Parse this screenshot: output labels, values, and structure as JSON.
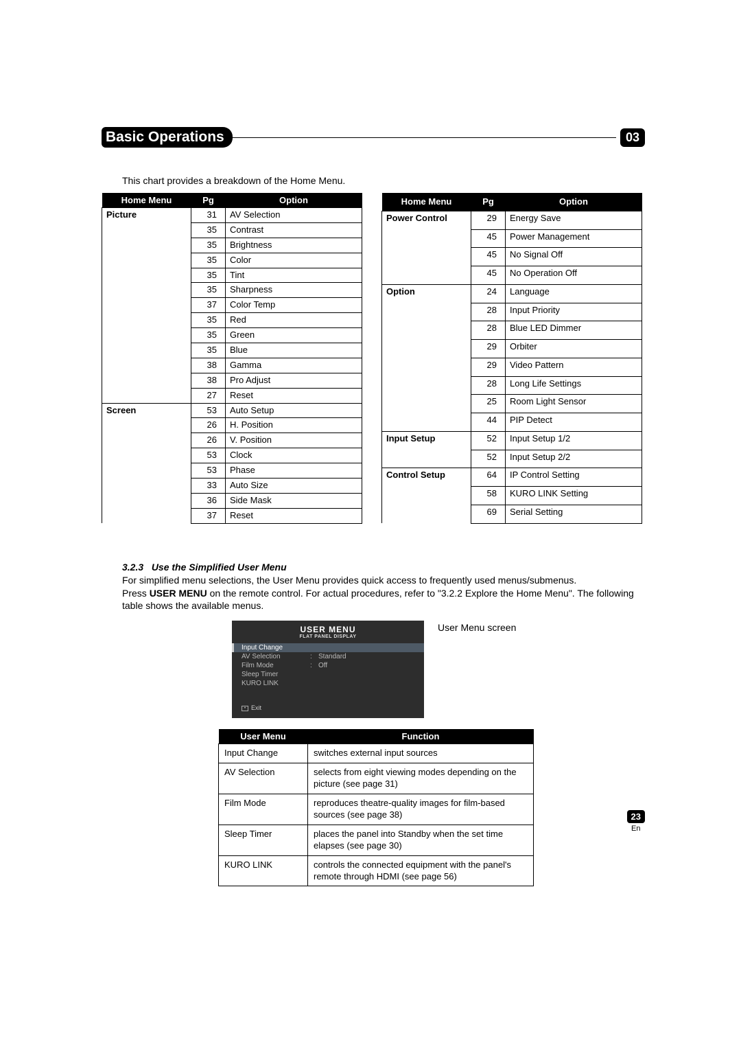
{
  "header": {
    "section_title": "Basic Operations",
    "chapter_number": "03"
  },
  "intro": "This chart provides a breakdown of the Home Menu.",
  "columns": {
    "home_menu": "Home Menu",
    "pg": "Pg",
    "option": "Option"
  },
  "left_table": [
    {
      "category": "Picture",
      "rows": [
        {
          "pg": "31",
          "option": "AV Selection"
        },
        {
          "pg": "35",
          "option": "Contrast"
        },
        {
          "pg": "35",
          "option": "Brightness"
        },
        {
          "pg": "35",
          "option": "Color"
        },
        {
          "pg": "35",
          "option": "Tint"
        },
        {
          "pg": "35",
          "option": "Sharpness"
        },
        {
          "pg": "37",
          "option": "Color Temp"
        },
        {
          "pg": "35",
          "option": "Red"
        },
        {
          "pg": "35",
          "option": "Green"
        },
        {
          "pg": "35",
          "option": "Blue"
        },
        {
          "pg": "38",
          "option": "Gamma"
        },
        {
          "pg": "38",
          "option": "Pro Adjust"
        },
        {
          "pg": "27",
          "option": "Reset"
        }
      ]
    },
    {
      "category": "Screen",
      "rows": [
        {
          "pg": "53",
          "option": "Auto Setup"
        },
        {
          "pg": "26",
          "option": "H. Position"
        },
        {
          "pg": "26",
          "option": "V. Position"
        },
        {
          "pg": "53",
          "option": "Clock"
        },
        {
          "pg": "53",
          "option": "Phase"
        },
        {
          "pg": "33",
          "option": "Auto Size"
        },
        {
          "pg": "36",
          "option": "Side Mask"
        },
        {
          "pg": "37",
          "option": "Reset"
        }
      ]
    }
  ],
  "right_table": [
    {
      "category": "Power Control",
      "rows": [
        {
          "pg": "29",
          "option": "Energy Save"
        },
        {
          "pg": "45",
          "option": "Power Management"
        },
        {
          "pg": "45",
          "option": "No Signal Off"
        },
        {
          "pg": "45",
          "option": "No Operation Off"
        }
      ]
    },
    {
      "category": "Option",
      "rows": [
        {
          "pg": "24",
          "option": "Language"
        },
        {
          "pg": "28",
          "option": "Input Priority"
        },
        {
          "pg": "28",
          "option": "Blue LED Dimmer"
        },
        {
          "pg": "29",
          "option": "Orbiter"
        },
        {
          "pg": "29",
          "option": "Video Pattern"
        },
        {
          "pg": "28",
          "option": "Long Life Settings"
        },
        {
          "pg": "25",
          "option": "Room Light Sensor"
        },
        {
          "pg": "44",
          "option": "PIP Detect"
        }
      ]
    },
    {
      "category": "Input Setup",
      "rows": [
        {
          "pg": "52",
          "option": "Input Setup 1/2"
        },
        {
          "pg": "52",
          "option": "Input Setup 2/2"
        }
      ]
    },
    {
      "category": "Control Setup",
      "rows": [
        {
          "pg": "64",
          "option": "IP Control Setting"
        },
        {
          "pg": "58",
          "option": "KURO LINK Setting"
        },
        {
          "pg": "69",
          "option": "Serial Setting"
        }
      ]
    }
  ],
  "subsection": {
    "number": "3.2.3",
    "title": "Use the Simplified User Menu",
    "para1": "For simplified menu selections, the User Menu provides quick access to frequently used menus/submenus.",
    "press_prefix": "Press ",
    "press_bold": "USER MENU",
    "press_suffix": " on the remote control. For actual procedures, refer to \"3.2.2 Explore the Home Menu\". The following table shows the available menus."
  },
  "screen": {
    "caption": "User Menu screen",
    "title": "USER MENU",
    "subtitle": "FLAT PANEL DISPLAY",
    "items": [
      {
        "label": "Input Change",
        "sep": "",
        "value": "",
        "hl": true
      },
      {
        "label": "AV Selection",
        "sep": ":",
        "value": "Standard",
        "hl": false
      },
      {
        "label": "Film Mode",
        "sep": ":",
        "value": "Off",
        "hl": false
      },
      {
        "label": "Sleep Timer",
        "sep": "",
        "value": "",
        "hl": false
      },
      {
        "label": "KURO LINK",
        "sep": "",
        "value": "",
        "hl": false
      }
    ],
    "exit_glyph": "•",
    "exit": "Exit"
  },
  "func_table": {
    "h1": "User Menu",
    "h2": "Function",
    "rows": [
      {
        "menu": "Input Change",
        "func": "switches external input sources"
      },
      {
        "menu": "AV Selection",
        "func": "selects from eight viewing modes depending on the picture (see page 31)"
      },
      {
        "menu": "Film Mode",
        "func": "reproduces theatre-quality images for film-based sources (see page 38)"
      },
      {
        "menu": "Sleep Timer",
        "func": "places the panel into Standby when the set time elapses (see page 30)"
      },
      {
        "menu": "KURO LINK",
        "func": "controls the connected equipment with the panel's remote through HDMI (see page 56)"
      }
    ]
  },
  "footer": {
    "page": "23",
    "lang": "En"
  }
}
